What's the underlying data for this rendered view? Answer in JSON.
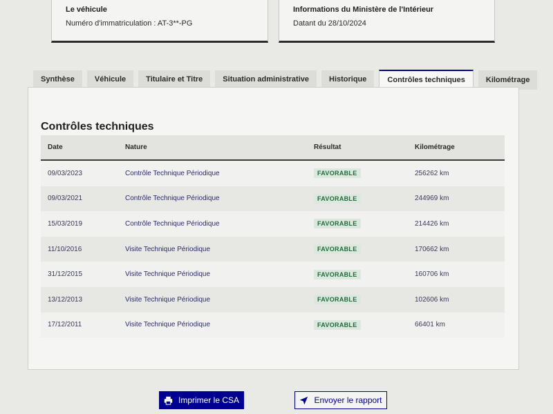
{
  "vehicule": {
    "title": "Le véhicule",
    "immatriculation": "Numéro d'immatriculation : AT-3**-PG"
  },
  "ministere": {
    "title": "Informations du Ministère de l'Intérieur",
    "date": "Datant du 28/10/2024"
  },
  "tabs": [
    {
      "label": "Synthèse",
      "active": false
    },
    {
      "label": "Véhicule",
      "active": false
    },
    {
      "label": "Titulaire et Titre",
      "active": false
    },
    {
      "label": "Situation administrative",
      "active": false
    },
    {
      "label": "Historique",
      "active": false
    },
    {
      "label": "Contrôles techniques",
      "active": true
    },
    {
      "label": "Kilométrage",
      "active": false
    }
  ],
  "section_title": "Contrôles techniques",
  "table": {
    "headers": {
      "date": "Date",
      "nature": "Nature",
      "result": "Résultat",
      "km": "Kilométrage"
    },
    "rows": [
      {
        "date": "09/03/2023",
        "nature": "Contrôle Technique Périodique",
        "result": "FAVORABLE",
        "km": "256262 km"
      },
      {
        "date": "09/03/2021",
        "nature": "Contrôle Technique Périodique",
        "result": "FAVORABLE",
        "km": "244969 km"
      },
      {
        "date": "15/03/2019",
        "nature": "Contrôle Technique Périodique",
        "result": "FAVORABLE",
        "km": "214426 km"
      },
      {
        "date": "11/10/2016",
        "nature": "Visite Technique Périodique",
        "result": "FAVORABLE",
        "km": "170662 km"
      },
      {
        "date": "31/12/2015",
        "nature": "Visite Technique Périodique",
        "result": "FAVORABLE",
        "km": "160706 km"
      },
      {
        "date": "13/12/2013",
        "nature": "Visite Technique Périodique",
        "result": "FAVORABLE",
        "km": "102606 km"
      },
      {
        "date": "17/12/2011",
        "nature": "Visite Technique Périodique",
        "result": "FAVORABLE",
        "km": "66401 km"
      }
    ]
  },
  "buttons": {
    "print": {
      "label": "Imprimer le CSA",
      "icon": "printer-icon"
    },
    "send": {
      "label": "Envoyer le rapport",
      "icon": "send-icon"
    }
  },
  "colors": {
    "primary": "#000091",
    "success_bg": "#dbe8dd",
    "success_text": "#1f6b3a"
  }
}
